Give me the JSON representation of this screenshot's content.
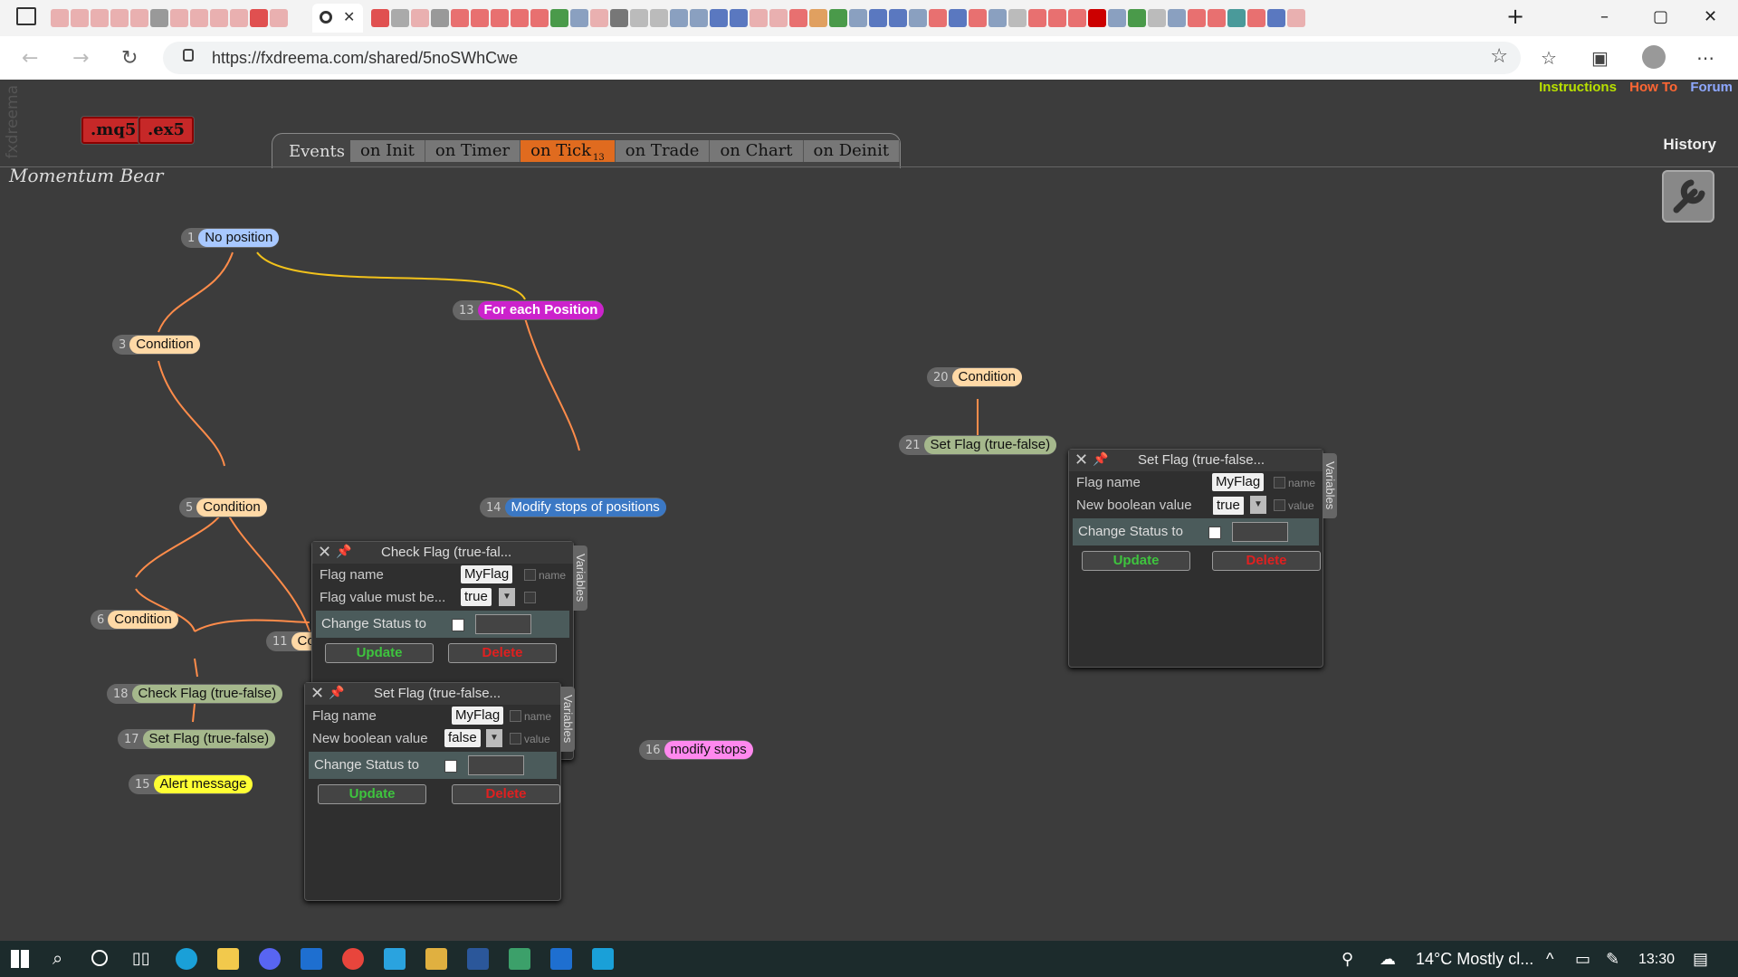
{
  "browser": {
    "url": "https://fxdreema.com/shared/5noSWhCwe",
    "new_tab_icon": "+",
    "minimize": "–",
    "maximize": "▢",
    "close": "✕"
  },
  "app": {
    "brand": "fxdreema",
    "export_mq5": ".mq5",
    "export_ex5": ".ex5",
    "project_title": "Momentum Bear",
    "links": {
      "instructions": "Instructions",
      "howto": "How To",
      "forum": "Forum"
    },
    "history": "History",
    "events_label": "Events",
    "event_tabs": [
      {
        "label": "on Init"
      },
      {
        "label": "on Timer"
      },
      {
        "label": "on Tick",
        "badge": "13"
      },
      {
        "label": "on Trade"
      },
      {
        "label": "on Chart"
      },
      {
        "label": "on Deinit"
      }
    ]
  },
  "nodes": [
    {
      "id": "1",
      "label": "No position",
      "color": "#a8c8ff"
    },
    {
      "id": "13",
      "label": "For each Position",
      "color": "#cc22cc"
    },
    {
      "id": "3",
      "label": "Condition",
      "color": "#ffd9a6"
    },
    {
      "id": "20",
      "label": "Condition",
      "color": "#ffd9a6"
    },
    {
      "id": "21",
      "label": "Set Flag (true-false)",
      "color": "#a5b88c"
    },
    {
      "id": "5",
      "label": "Condition",
      "color": "#ffd9a6"
    },
    {
      "id": "14",
      "label": "Modify stops of positions",
      "color": "#3b78c4"
    },
    {
      "id": "6",
      "label": "Condition",
      "color": "#ffd9a6"
    },
    {
      "id": "11",
      "label": "Co",
      "color": "#ffd9a6"
    },
    {
      "id": "18",
      "label": "Check Flag (true-false)",
      "color": "#a5b88c"
    },
    {
      "id": "17",
      "label": "Set Flag (true-false)",
      "color": "#a5b88c"
    },
    {
      "id": "15",
      "label": "Alert message",
      "color": "#ffff33"
    },
    {
      "id": "16",
      "label": "modify stops",
      "color": "#ff88ee"
    }
  ],
  "panels": {
    "check_flag": {
      "title": "Check Flag (true-fal...",
      "flag_name_label": "Flag name",
      "flag_name_value": "MyFlag",
      "flag_name_hint": "name",
      "flag_value_label": "Flag value must be...",
      "flag_value_value": "true",
      "change_status": "Change Status to",
      "update": "Update",
      "delete": "Delete",
      "variables": "Variables"
    },
    "set_flag_a": {
      "title": "Set Flag (true-false...",
      "flag_name_label": "Flag name",
      "flag_name_value": "MyFlag",
      "flag_name_hint": "name",
      "bool_label": "New boolean value",
      "bool_value": "false",
      "bool_hint": "value",
      "change_status": "Change Status to",
      "update": "Update",
      "delete": "Delete",
      "variables": "Variables"
    },
    "set_flag_b": {
      "title": "Set Flag (true-false...",
      "flag_name_label": "Flag name",
      "flag_name_value": "MyFlag",
      "flag_name_hint": "name",
      "bool_label": "New boolean value",
      "bool_value": "true",
      "bool_hint": "value",
      "change_status": "Change Status to",
      "update": "Update",
      "delete": "Delete",
      "variables": "Variables"
    }
  },
  "taskbar": {
    "weather": "14°C  Mostly cl...",
    "time": "13:30"
  }
}
